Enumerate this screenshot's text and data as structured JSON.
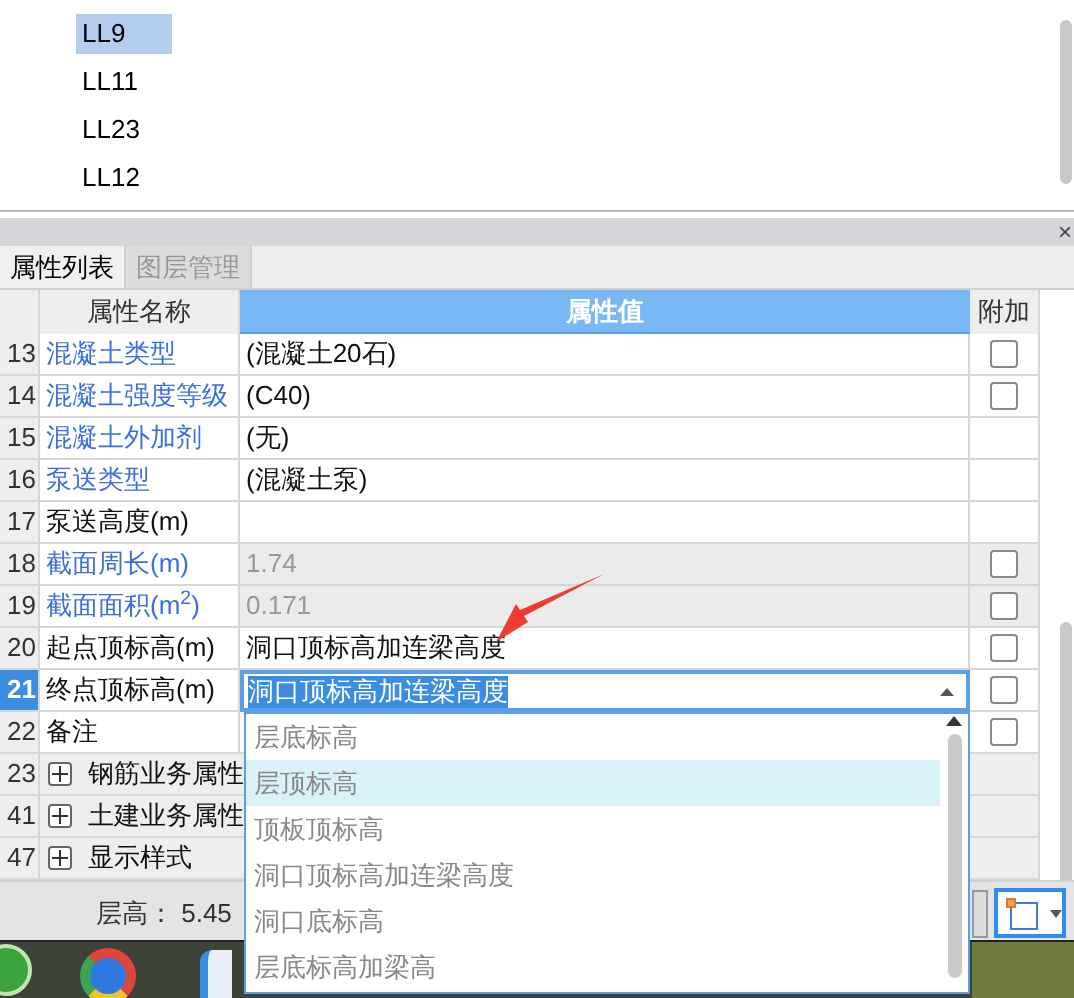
{
  "list": [
    {
      "label": "LL9",
      "selected": true
    },
    {
      "label": "LL11",
      "selected": false
    },
    {
      "label": "LL23",
      "selected": false
    },
    {
      "label": "LL12",
      "selected": false
    }
  ],
  "panel_close": "×",
  "tabs": [
    {
      "label": "属性列表",
      "selected": true
    },
    {
      "label": "图层管理",
      "selected": false
    }
  ],
  "columns": [
    "属性名称",
    "属性值",
    "附加"
  ],
  "rows": [
    {
      "kind": "property",
      "number": "13",
      "name": "混凝土类型",
      "value": "(混凝土20石)",
      "public": true,
      "readonly": false,
      "addon": {
        "checked": false
      },
      "selected": false
    },
    {
      "kind": "property",
      "number": "14",
      "name": "混凝土强度等级",
      "value": "(C40)",
      "public": true,
      "readonly": false,
      "addon": {
        "checked": false
      },
      "selected": false
    },
    {
      "kind": "property",
      "number": "15",
      "name": "混凝土外加剂",
      "value": "(无)",
      "public": true,
      "readonly": false,
      "selected": false
    },
    {
      "kind": "property",
      "number": "16",
      "name": "泵送类型",
      "value": "(混凝土泵)",
      "public": true,
      "readonly": false,
      "selected": false
    },
    {
      "kind": "property",
      "number": "17",
      "name": "泵送高度(m)",
      "public": false,
      "readonly": false,
      "selected": false
    },
    {
      "kind": "property",
      "number": "18",
      "name": "截面周长(m)",
      "value": "1.74",
      "public": true,
      "readonly": true,
      "addon": {
        "checked": false
      },
      "selected": false
    },
    {
      "kind": "property",
      "number": "19",
      "name": "截面面积(m$^{2}$)",
      "value": "0.171",
      "public": true,
      "readonly": true,
      "addon": {
        "checked": false
      },
      "selected": false
    },
    {
      "kind": "property",
      "number": "20",
      "name": "起点顶标高(m)",
      "value": "洞口顶标高加连梁高度",
      "public": false,
      "readonly": false,
      "addon": {
        "checked": false
      },
      "selected": false
    },
    {
      "kind": "property",
      "number": "21",
      "name": "终点顶标高(m)",
      "value": "洞口顶标高加连梁高度",
      "public": false,
      "readonly": false,
      "addon": {
        "checked": false
      },
      "selected": true
    },
    {
      "kind": "property",
      "number": "22",
      "name": "备注",
      "public": false,
      "readonly": false,
      "addon": {
        "checked": false
      },
      "selected": false
    },
    {
      "kind": "group",
      "number": "23",
      "name": "钢筋业务属性",
      "expanded": false
    },
    {
      "kind": "group",
      "number": "41",
      "name": "土建业务属性",
      "expanded": false
    },
    {
      "kind": "group",
      "number": "47",
      "name": "显示样式",
      "expanded": false
    }
  ],
  "dropdown": {
    "options": [
      {
        "label": "层底标高",
        "selected": false
      },
      {
        "label": "层顶标高",
        "selected": true
      },
      {
        "label": "顶板顶标高",
        "selected": false
      },
      {
        "label": "洞口顶标高加连梁高度",
        "selected": false
      },
      {
        "label": "洞口底标高",
        "selected": false
      },
      {
        "label": "层底标高加梁高",
        "selected": false
      }
    ]
  },
  "status_bar": {
    "floor_height": "层高： 5.45"
  }
}
